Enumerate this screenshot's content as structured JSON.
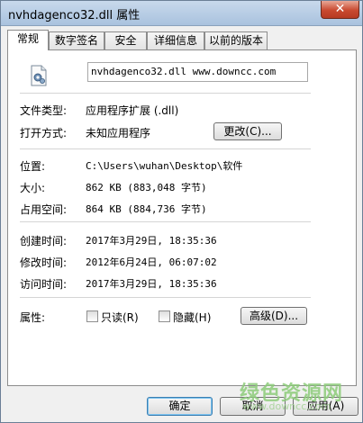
{
  "window": {
    "title": "nvhdagenco32.dll 属性",
    "close_glyph": "✕"
  },
  "tabs": [
    {
      "label": "常规"
    },
    {
      "label": "数字签名"
    },
    {
      "label": "安全"
    },
    {
      "label": "详细信息"
    },
    {
      "label": "以前的版本"
    }
  ],
  "general": {
    "file_name": "nvhdagenco32.dll  www.downcc.com",
    "file_type_label": "文件类型:",
    "file_type_value": "应用程序扩展 (.dll)",
    "opens_with_label": "打开方式:",
    "opens_with_value": "未知应用程序",
    "change_button": "更改(C)...",
    "location_label": "位置:",
    "location_value": "C:\\Users\\wuhan\\Desktop\\软件",
    "size_label": "大小:",
    "size_value": "862 KB (883,048 字节)",
    "size_on_disk_label": "占用空间:",
    "size_on_disk_value": "864 KB (884,736 字节)",
    "created_label": "创建时间:",
    "created_value": "2017年3月29日, 18:35:36",
    "modified_label": "修改时间:",
    "modified_value": "2012年6月24日, 06:07:02",
    "accessed_label": "访问时间:",
    "accessed_value": "2017年3月29日, 18:35:36",
    "attributes_label": "属性:",
    "readonly_label": "只读(R)",
    "hidden_label": "隐藏(H)",
    "advanced_button": "高级(D)..."
  },
  "footer": {
    "ok_button": "确定",
    "cancel_button": "取消",
    "apply_button": "应用(A)"
  },
  "watermark": {
    "text": "绿色资源网",
    "sub": "www.downcc.com"
  }
}
